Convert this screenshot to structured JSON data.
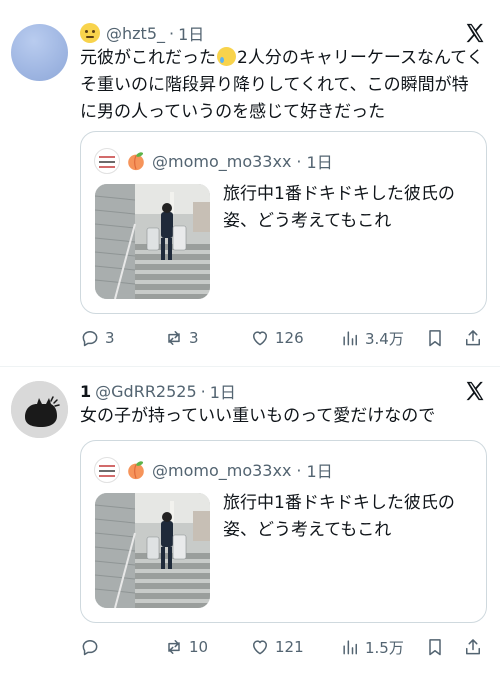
{
  "posts": [
    {
      "handle": "@hzt5_",
      "separator": "·",
      "time": "1日",
      "text_before_emoji": "元彼がこれだった",
      "text_after_emoji": "2人分のキャリーケースなんてくそ重いのに階段昇り降りしてくれて、この瞬間が特に男の人っていうのを感じて好きだった",
      "quote": {
        "handle": "@momo_mo33xx",
        "separator": "·",
        "time": "1日",
        "text": "旅行中1番ドキドキした彼氏の姿、どう考えてもこれ"
      },
      "stats": {
        "replies": "3",
        "reposts": "3",
        "likes": "126",
        "views": "3.4万"
      }
    },
    {
      "display_name": "1",
      "handle": "@GdRR2525",
      "separator": "·",
      "time": "1日",
      "text": "女の子が持っていい重いものって愛だけなので",
      "quote": {
        "handle": "@momo_mo33xx",
        "separator": "·",
        "time": "1日",
        "text": "旅行中1番ドキドキした彼氏の姿、どう考えてもこれ"
      },
      "stats": {
        "replies": "",
        "reposts": "10",
        "likes": "121",
        "views": "1.5万"
      }
    }
  ],
  "icons": {
    "brand": "x-logo-icon",
    "reply": "reply-icon",
    "repost": "repost-icon",
    "like": "heart-icon",
    "views": "views-icon",
    "bookmark": "bookmark-icon",
    "share": "share-icon"
  },
  "colors": {
    "text": "#0f1419",
    "secondary": "#536471",
    "border": "#cfd9de",
    "divider": "#eff3f4"
  }
}
